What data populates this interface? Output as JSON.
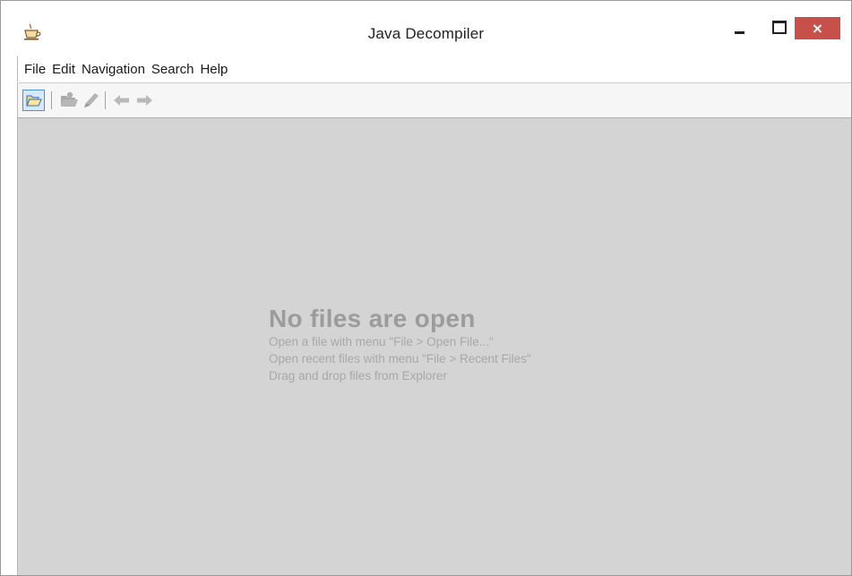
{
  "window": {
    "title": "Java Decompiler",
    "controls": {
      "minimize": "minimize",
      "maximize": "maximize",
      "close": "×"
    },
    "close_color": "#c7504b",
    "app_icon": "coffee-cup-icon"
  },
  "menubar": {
    "items": [
      {
        "label": "File"
      },
      {
        "label": "Edit"
      },
      {
        "label": "Navigation"
      },
      {
        "label": "Search"
      },
      {
        "label": "Help"
      }
    ]
  },
  "toolbar": {
    "buttons": [
      {
        "icon": "open-folder-icon",
        "state": "active"
      },
      {
        "icon": "open-recent-icon",
        "state": "disabled"
      },
      {
        "icon": "edit-pen-icon",
        "state": "disabled"
      },
      {
        "icon": "back-arrow-icon",
        "state": "disabled"
      },
      {
        "icon": "forward-arrow-icon",
        "state": "disabled"
      }
    ]
  },
  "content": {
    "background": "#d4d4d4",
    "empty_state": {
      "title": "No files are open",
      "lines": [
        "Open a file with menu \"File > Open File...\"",
        "Open recent files with menu \"File > Recent Files\"",
        "Drag and drop files from Explorer"
      ]
    }
  }
}
